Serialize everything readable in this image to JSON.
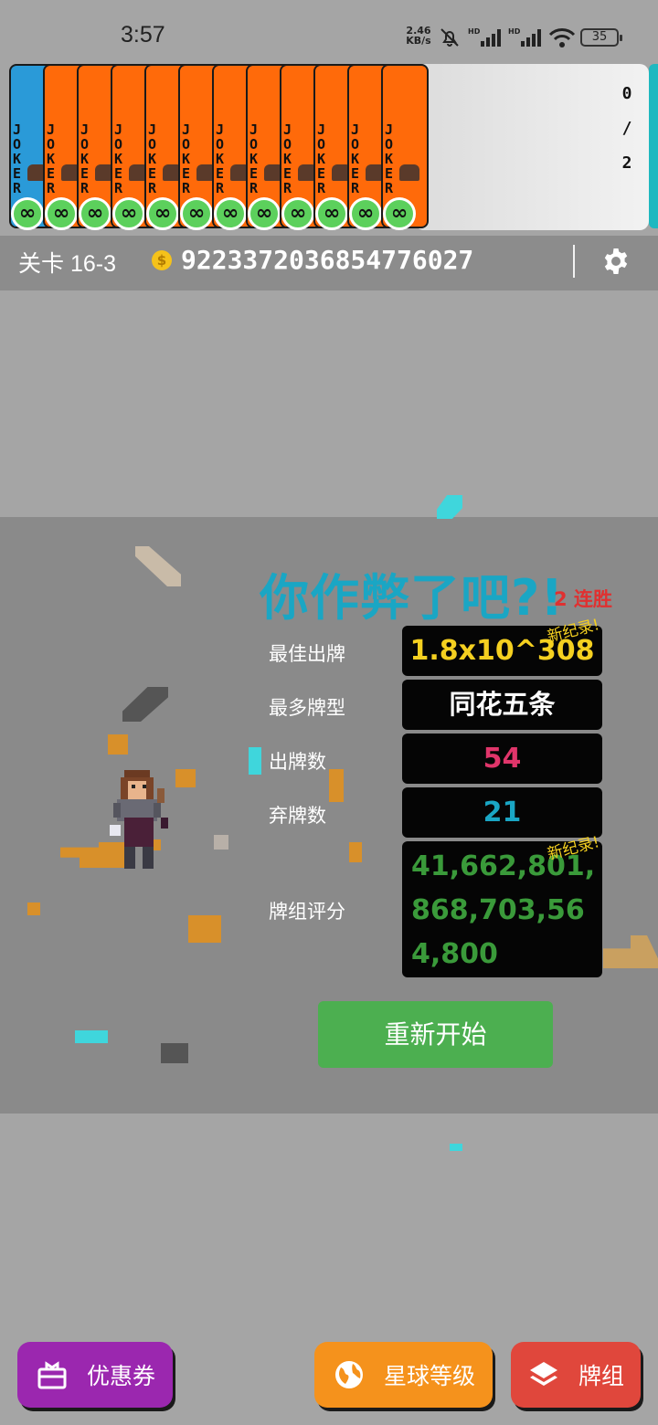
{
  "status_bar": {
    "time": "3:57",
    "net_speed_value": "2.46",
    "net_speed_unit": "KB/s",
    "battery": "35"
  },
  "hand": {
    "card_text": "JOKER",
    "infinite_symbol": "∞",
    "preview_count": [
      "0",
      "/",
      "2"
    ]
  },
  "info_bar": {
    "level": "关卡 16-3",
    "coin_symbol": "$",
    "money": "9223372036854776027"
  },
  "result": {
    "title": "你作弊了吧?!",
    "streak": "2 连胜",
    "new_record": "新纪录!",
    "best_hand_label": "最佳出牌",
    "best_hand_value": "1.8x10^308",
    "most_hand_type_label": "最多牌型",
    "most_hand_type_value": "同花五条",
    "hands_played_label": "出牌数",
    "hands_played_value": "54",
    "discards_label": "弃牌数",
    "discards_value": "21",
    "deck_score_label": "牌组评分",
    "deck_score_lines": [
      "41,662,801,",
      "868,703,56",
      "4,800"
    ],
    "restart_label": "重新开始"
  },
  "bottom_nav": {
    "coupon_label": "优惠券",
    "planet_label": "星球等级",
    "deck_label": "牌组"
  },
  "colors": {
    "title": "#1aa6c4",
    "best_hand": "#f5d020",
    "hands_played": "#e0356a",
    "discards": "#1aa6c4",
    "deck_score": "#3a9a3a",
    "restart": "#4caf50",
    "coupon": "#9b27af",
    "planet": "#f5921c",
    "deck": "#e0473c"
  }
}
